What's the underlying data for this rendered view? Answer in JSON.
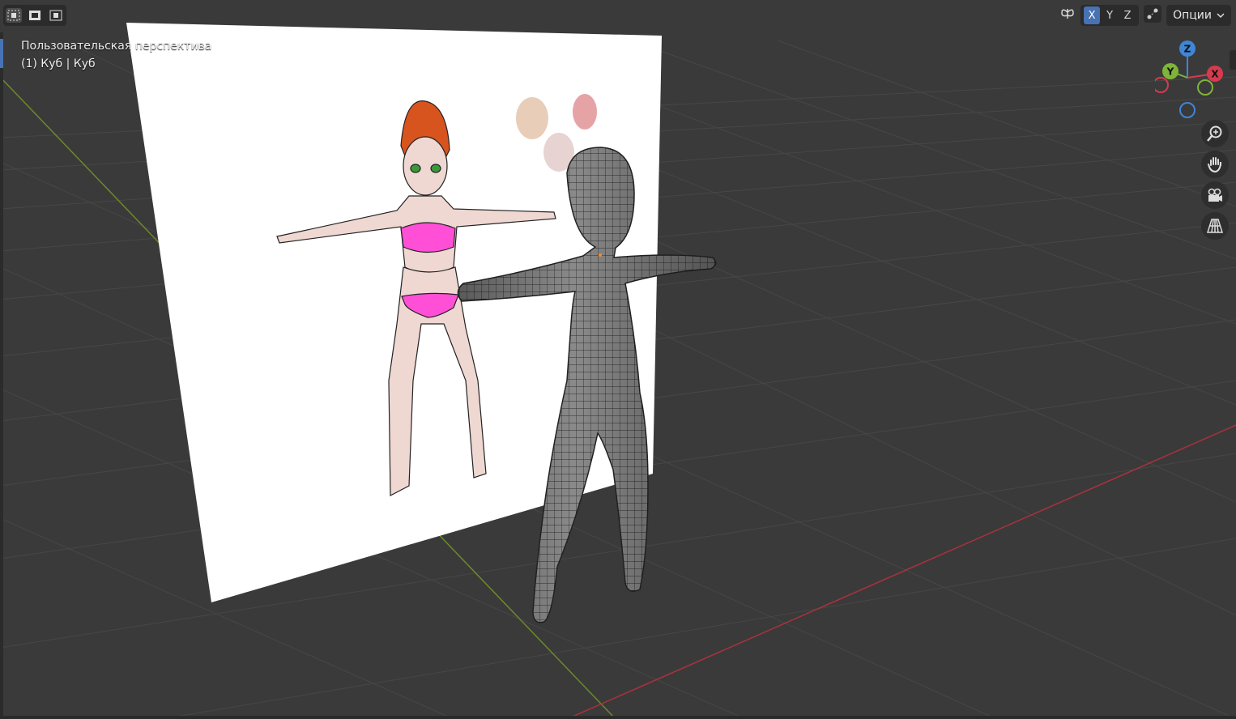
{
  "header": {
    "view_label": "Пользовательская перспектива",
    "object_label": "(1) Куб | Куб",
    "options_label": "Опции"
  },
  "mirror": {
    "x": "X",
    "y": "Y",
    "z": "Z"
  },
  "gizmo": {
    "x": "X",
    "y": "Y",
    "z": "Z"
  },
  "icons": {
    "select_modes": [
      "select-box-icon",
      "select-extend-icon",
      "select-subtract-icon"
    ],
    "mirror": "butterfly-symmetry-icon",
    "snap": "snapping-icon",
    "nav": [
      "zoom-icon",
      "pan-hand-icon",
      "camera-icon",
      "perspective-grid-icon"
    ]
  },
  "colors": {
    "viewport_bg": "#3a3a3a",
    "axis_x": "#d63a4f",
    "axis_y": "#7fb43a",
    "axis_z": "#3f86d6",
    "accent": "#4772b3"
  }
}
